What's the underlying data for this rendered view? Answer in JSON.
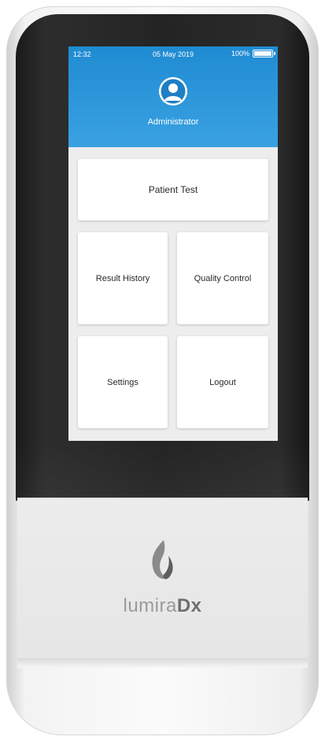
{
  "status_bar": {
    "time": "12:32",
    "date": "05 May 2019",
    "battery": "100%"
  },
  "user": {
    "name": "Administrator"
  },
  "menu": {
    "patient_test": "Patient Test",
    "result_history": "Result History",
    "quality_control": "Quality Control",
    "settings": "Settings",
    "logout": "Logout"
  },
  "brand": {
    "prefix": "lumira",
    "suffix": "Dx"
  },
  "colors": {
    "header_blue": "#2a95dc",
    "bezel": "#242424",
    "tile_bg": "#ffffff"
  },
  "icons": {
    "avatar": "user-avatar-icon",
    "battery": "battery-full-icon",
    "logo": "flame-logo-icon"
  }
}
